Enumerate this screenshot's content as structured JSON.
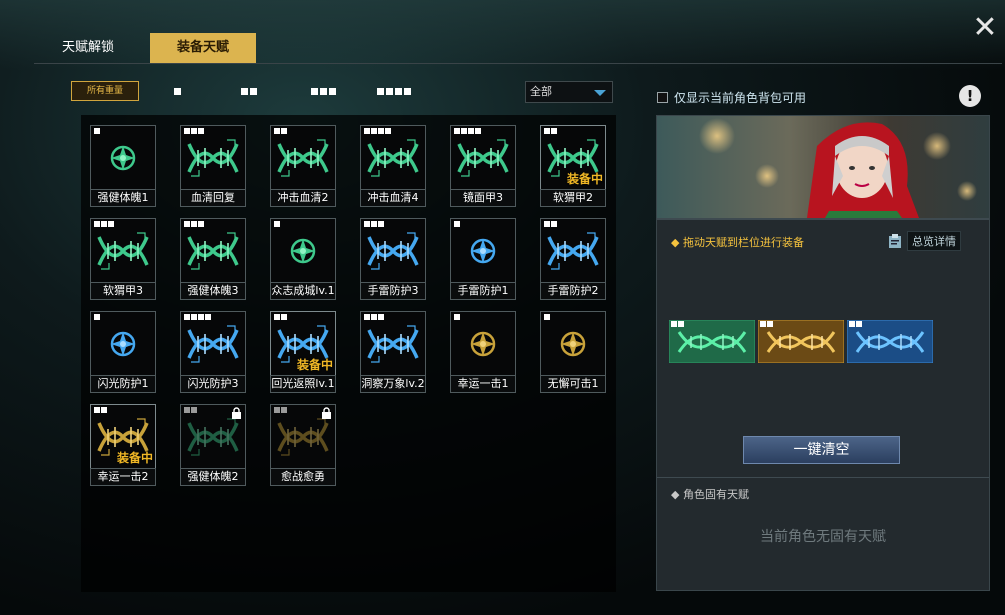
{
  "tabs": [
    {
      "label": "天赋解锁",
      "active": false
    },
    {
      "label": "装备天赋",
      "active": true
    }
  ],
  "close_icon": "close-icon",
  "filters": {
    "all_label": "所有重量",
    "weights": [
      1,
      2,
      3,
      4
    ],
    "dropdown_value": "全部"
  },
  "colors": {
    "accent_gold": "#dcb44f",
    "equipped_text": "#f1b826",
    "green_dna": "#3ec98c",
    "blue_dna": "#45a8f0",
    "gold_dna": "#c8a23a"
  },
  "equipped_label": "装备中",
  "talents": [
    {
      "label": "强健体魄1",
      "weight": 1,
      "icon": "emblem-green-icon",
      "equipped": false,
      "locked": false
    },
    {
      "label": "血清回复",
      "weight": 3,
      "icon": "dna-green-icon",
      "equipped": false,
      "locked": false
    },
    {
      "label": "冲击血清2",
      "weight": 2,
      "icon": "dna-green-icon",
      "equipped": false,
      "locked": false
    },
    {
      "label": "冲击血清4",
      "weight": 4,
      "icon": "dna-green-icon",
      "equipped": false,
      "locked": false
    },
    {
      "label": "镜面甲3",
      "weight": 4,
      "icon": "dna-green-icon",
      "equipped": false,
      "locked": false
    },
    {
      "label": "软猬甲2",
      "weight": 2,
      "icon": "dna-green-icon",
      "equipped": true,
      "locked": false
    },
    {
      "label": "软猬甲3",
      "weight": 3,
      "icon": "dna-green-icon",
      "equipped": false,
      "locked": false
    },
    {
      "label": "强健体魄3",
      "weight": 3,
      "icon": "dna-green-icon",
      "equipped": false,
      "locked": false
    },
    {
      "label": "众志成城lv.1",
      "weight": 1,
      "icon": "emblem-green-icon",
      "equipped": false,
      "locked": false
    },
    {
      "label": "手雷防护3",
      "weight": 3,
      "icon": "dna-blue-icon",
      "equipped": false,
      "locked": false
    },
    {
      "label": "手雷防护1",
      "weight": 1,
      "icon": "emblem-blue-icon",
      "equipped": false,
      "locked": false
    },
    {
      "label": "手雷防护2",
      "weight": 2,
      "icon": "dna-blue-icon",
      "equipped": false,
      "locked": false
    },
    {
      "label": "闪光防护1",
      "weight": 1,
      "icon": "emblem-blue-icon",
      "equipped": false,
      "locked": false
    },
    {
      "label": "闪光防护3",
      "weight": 4,
      "icon": "dna-blue-icon",
      "equipped": false,
      "locked": false
    },
    {
      "label": "回光返照lv.1",
      "weight": 2,
      "icon": "dna-blue-icon",
      "equipped": true,
      "locked": false
    },
    {
      "label": "洞察万象lv.2",
      "weight": 3,
      "icon": "dna-blue-icon",
      "equipped": false,
      "locked": false
    },
    {
      "label": "幸运一击1",
      "weight": 1,
      "icon": "emblem-gold-icon",
      "equipped": false,
      "locked": false
    },
    {
      "label": "无懈可击1",
      "weight": 1,
      "icon": "emblem-gold-icon",
      "equipped": false,
      "locked": false
    },
    {
      "label": "幸运一击2",
      "weight": 2,
      "icon": "dna-gold-icon",
      "equipped": true,
      "locked": false
    },
    {
      "label": "强健体魄2",
      "weight": 2,
      "icon": "dna-green-icon",
      "equipped": false,
      "locked": true
    },
    {
      "label": "愈战愈勇",
      "weight": 2,
      "icon": "dna-gold-icon",
      "equipped": false,
      "locked": true
    }
  ],
  "right": {
    "checkbox_label": "仅显示当前角色背包可用",
    "info_icon": "info-icon",
    "drag_hint": "拖动天赋到栏位进行装备",
    "overview_label": "总览详情",
    "slots": [
      {
        "color": "green",
        "weight": 2
      },
      {
        "color": "gold",
        "weight": 2
      },
      {
        "color": "blue",
        "weight": 2
      }
    ],
    "clear_label": "一键清空",
    "innate_title": "角色固有天赋",
    "innate_empty": "当前角色无固有天赋"
  }
}
